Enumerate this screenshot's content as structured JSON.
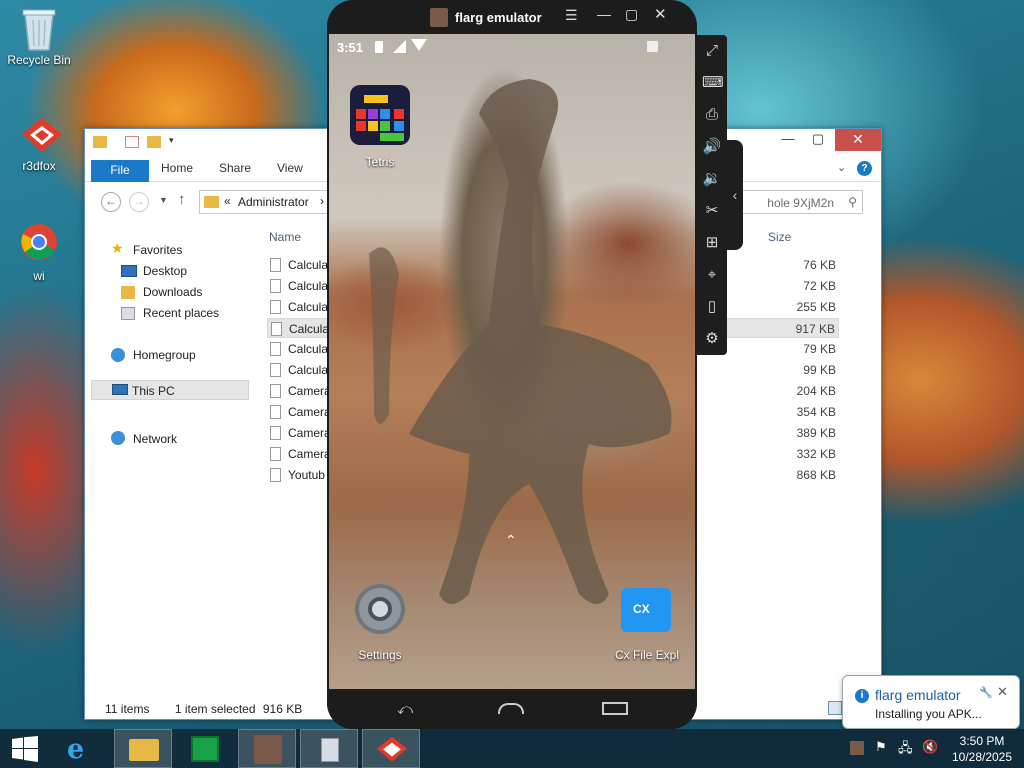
{
  "desktop": {
    "icons": [
      {
        "label": "Recycle Bin",
        "icon": "recycle-bin-icon"
      },
      {
        "label": "r3dfox",
        "icon": "r3dfox-icon"
      },
      {
        "label": "wi",
        "icon": "chrome-icon"
      }
    ]
  },
  "explorer": {
    "tabs": {
      "file": "File",
      "home": "Home",
      "share": "Share",
      "view": "View"
    },
    "address": {
      "chevron": "«",
      "path": "Administrator",
      "sep": "›"
    },
    "search": {
      "value": "hole 9XjM2n"
    },
    "columns": {
      "name": "Name",
      "size": "Size"
    },
    "nav": {
      "favorites": "Favorites",
      "desktop": "Desktop",
      "downloads": "Downloads",
      "recent": "Recent places",
      "homegroup": "Homegroup",
      "thispc": "This PC",
      "network": "Network"
    },
    "files": [
      {
        "name": "Calcula",
        "size": "76 KB"
      },
      {
        "name": "Calcula",
        "size": "72 KB"
      },
      {
        "name": "Calcula",
        "size": "255 KB"
      },
      {
        "name": "Calcula",
        "size": "917 KB"
      },
      {
        "name": "Calcula",
        "size": "79 KB"
      },
      {
        "name": "Calcula",
        "size": "99 KB"
      },
      {
        "name": "Camera",
        "size": "204 KB"
      },
      {
        "name": "Camera",
        "size": "354 KB"
      },
      {
        "name": "Camera",
        "size": "389 KB"
      },
      {
        "name": "Camera",
        "size": "332 KB"
      },
      {
        "name": "Youtub",
        "size": "868 KB"
      }
    ],
    "status": {
      "items": "11 items",
      "selected": "1 item selected",
      "size": "916 KB"
    }
  },
  "emulator": {
    "title": "flarg emulator",
    "statusbar": {
      "time": "3:51"
    },
    "apps": {
      "tetris": "Tetris",
      "settings": "Settings",
      "cxfile": "Cx File Expl",
      "cx_badge": "CX"
    }
  },
  "taskbar": {
    "time": "3:50 PM",
    "date": "10/28/2025"
  },
  "notification": {
    "title": "flarg emulator",
    "message": "Installing you APK..."
  },
  "colors": {
    "file_tab": "#1979ca",
    "close_button": "#c7504b",
    "selection": "#cce8ff"
  }
}
